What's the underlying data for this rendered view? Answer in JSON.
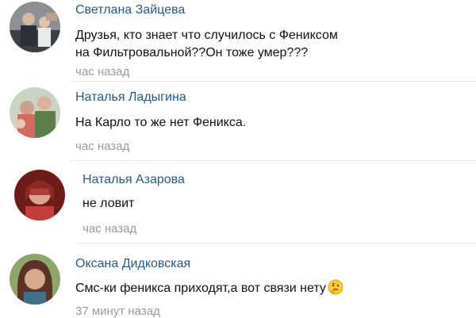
{
  "comments": [
    {
      "author": "Светлана Зайцева",
      "text_line1": "Друзья, кто знает что случилось с Фениксом",
      "text_line2": "на Фильтровальной??Он  тоже умер???",
      "time": "час назад"
    },
    {
      "author": "Наталья Ладыгина",
      "text_line1": "На Карло то же нет Феникса.",
      "time": "час назад"
    },
    {
      "author": "Наталья Азарова",
      "text_line1": "не ловит",
      "time": "час назад"
    },
    {
      "author": "Оксана Дидковская",
      "text_line1": "Смс-ки феникса приходят,а вот связи нету",
      "emoji": "thinking-face",
      "time": "37 минут назад"
    }
  ],
  "colors": {
    "author_link": "#2a5885",
    "meta_text": "#9a9a9a",
    "divider": "#e4e6ea"
  }
}
